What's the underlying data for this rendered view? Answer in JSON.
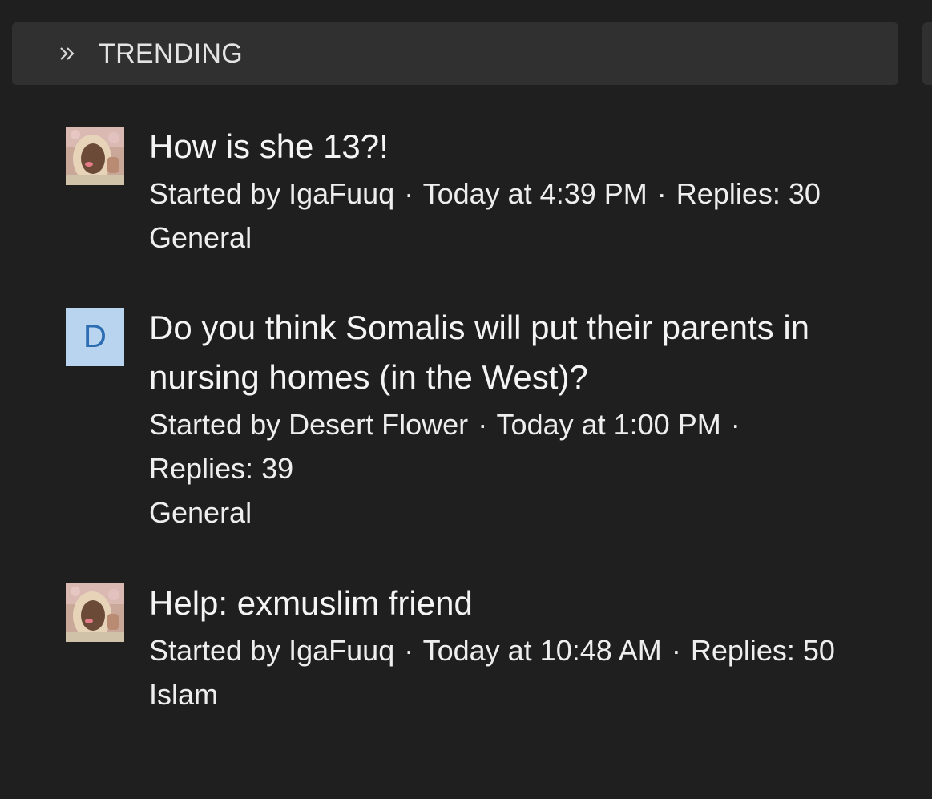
{
  "block": {
    "title": "TRENDING",
    "icon": "double-chevron-right-icon"
  },
  "threads": [
    {
      "title": "How is she 13?!",
      "started_prefix": "Started by",
      "author": "IgaFuuq",
      "time": "Today at 4:39 PM",
      "replies": "Replies: 30",
      "forum": "General",
      "avatar_type": "photo"
    },
    {
      "title": "Do you think Somalis will put their parents in nursing homes (in the West)?",
      "started_prefix": "Started by",
      "author": "Desert Flower",
      "time": "Today at 1:00 PM",
      "replies": "Replies: 39",
      "forum": "General",
      "avatar_type": "letter",
      "avatar_letter": "D"
    },
    {
      "title": "Help: exmuslim friend",
      "started_prefix": "Started by",
      "author": "IgaFuuq",
      "time": "Today at 10:48 AM",
      "replies": "Replies: 50",
      "forum": "Islam",
      "avatar_type": "photo"
    }
  ],
  "separator": "·",
  "colors": {
    "background": "#1f1f1f",
    "header_bg": "#303030",
    "letter_avatar_bg": "#b9d4ee",
    "letter_avatar_fg": "#2b6cb3"
  }
}
